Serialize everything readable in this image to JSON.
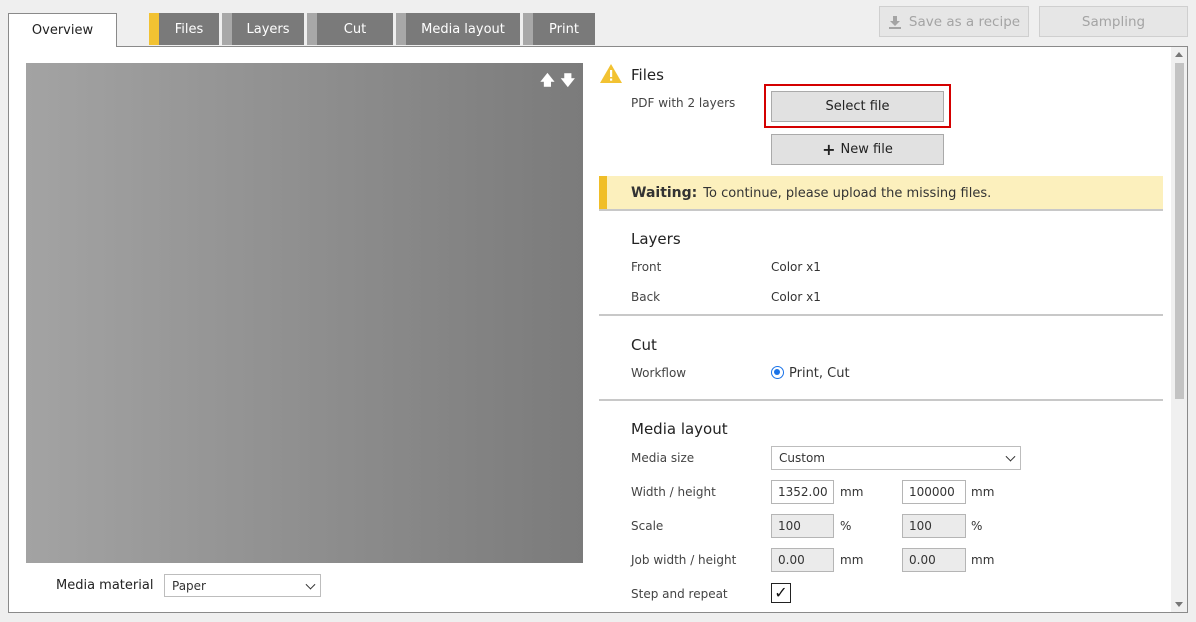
{
  "tabs": {
    "overview": "Overview",
    "items": [
      "Files",
      "Layers",
      "Cut",
      "Media layout",
      "Print"
    ]
  },
  "toolbar": {
    "save_recipe": "Save as a recipe",
    "sampling": "Sampling"
  },
  "preview": {
    "media_material_label": "Media material",
    "media_material_value": "Paper"
  },
  "files": {
    "title": "Files",
    "description": "PDF with 2 layers",
    "select_file": "Select file",
    "new_file": "New file"
  },
  "waiting": {
    "label": "Waiting:",
    "message": "To continue, please upload the missing files."
  },
  "layers": {
    "title": "Layers",
    "front_label": "Front",
    "front_value": "Color x1",
    "back_label": "Back",
    "back_value": "Color x1"
  },
  "cut": {
    "title": "Cut",
    "workflow_label": "Workflow",
    "workflow_value": "Print, Cut"
  },
  "media_layout": {
    "title": "Media layout",
    "media_size_label": "Media size",
    "media_size_value": "Custom",
    "width_height_label": "Width / height",
    "width_value": "1352.00",
    "height_value": "100000",
    "unit_mm": "mm",
    "scale_label": "Scale",
    "scale_x": "100",
    "scale_y": "100",
    "unit_pct": "%",
    "job_wh_label": "Job width / height",
    "job_width": "0.00",
    "job_height": "0.00",
    "step_repeat_label": "Step and repeat",
    "check_mark": "✓"
  }
}
